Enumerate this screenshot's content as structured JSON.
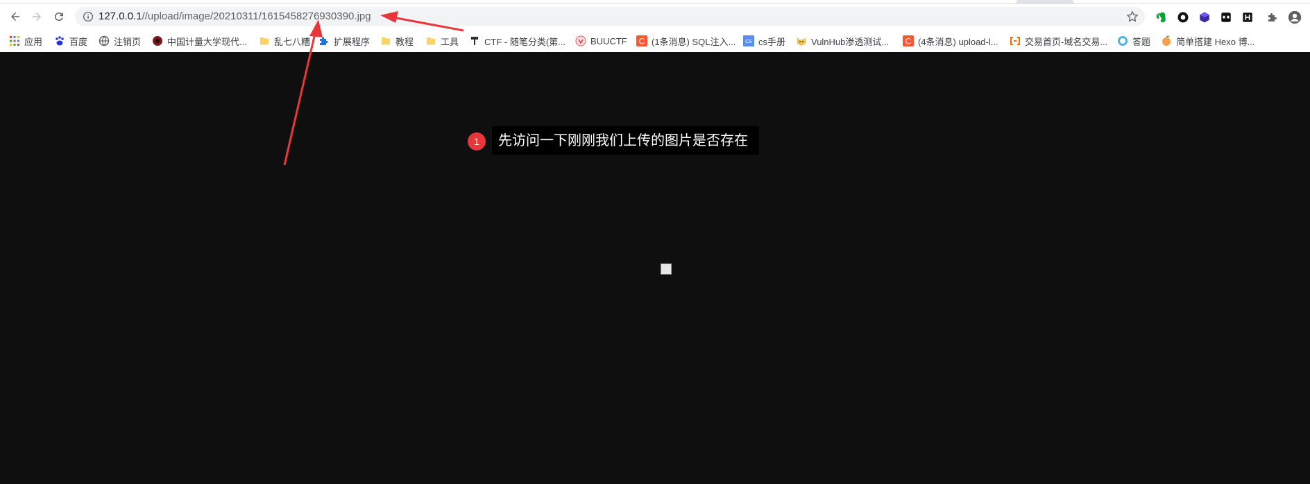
{
  "browser": {
    "nav": {
      "back_icon": "arrow-left-icon",
      "forward_icon": "arrow-right-icon",
      "reload_icon": "reload-icon"
    },
    "address_bar": {
      "host": "127.0.0.1",
      "path": "//upload/image/20210311/1615458276930390.jpg",
      "info_icon": "info-icon",
      "bookmark_star_icon": "star-icon"
    },
    "extensions": [
      "evernote-icon",
      "circle-icon",
      "cube-icon",
      "bot-icon",
      "h-icon",
      "puzzle-icon",
      "profile-avatar-icon"
    ]
  },
  "bookmarks": [
    {
      "label": "应用",
      "icon": "apps-grid-icon"
    },
    {
      "label": "百度",
      "icon": "baidu-paw-icon"
    },
    {
      "label": "注销页",
      "icon": "globe-icon"
    },
    {
      "label": "中国计量大学现代...",
      "icon": "site-logo-icon"
    },
    {
      "label": "乱七八糟",
      "icon": "folder-icon"
    },
    {
      "label": "扩展程序",
      "icon": "puzzle-icon"
    },
    {
      "label": "教程",
      "icon": "folder-icon"
    },
    {
      "label": "工具",
      "icon": "folder-icon"
    },
    {
      "label": "CTF - 随笔分类(第...",
      "icon": "ctf-logo-icon"
    },
    {
      "label": "BUUCTF",
      "icon": "buuctf-logo-icon"
    },
    {
      "label": "(1条消息) SQL注入...",
      "icon": "csdn-c-icon"
    },
    {
      "label": "cs手册",
      "icon": "cs-icon"
    },
    {
      "label": "VulnHub渗透测试...",
      "icon": "vulnhub-icon"
    },
    {
      "label": "(4条消息) upload-l...",
      "icon": "csdn-c-icon"
    },
    {
      "label": "交易首页-域名交易...",
      "icon": "aliyun-icon"
    },
    {
      "label": "答题",
      "icon": "quiz-icon"
    },
    {
      "label": "简单搭建 Hexo 博...",
      "icon": "peach-icon"
    }
  ],
  "annotation": {
    "step_number": "1",
    "text": "先访问一下刚刚我们上传的图片是否存在"
  },
  "colors": {
    "page_bg": "#0f0f0f",
    "annotation_red": "#e8373b",
    "chrome_bg": "#ffffff",
    "omnibox_bg": "#f1f3f4"
  }
}
